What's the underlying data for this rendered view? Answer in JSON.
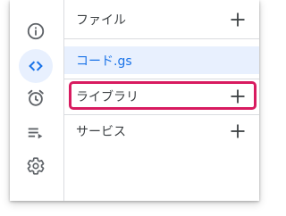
{
  "sidebar": {
    "items": [
      {
        "name": "info",
        "icon": "info-icon",
        "active": false
      },
      {
        "name": "editor",
        "icon": "code-icon",
        "active": true
      },
      {
        "name": "triggers",
        "icon": "alarm-clock-icon",
        "active": false
      },
      {
        "name": "executions",
        "icon": "executions-icon",
        "active": false
      },
      {
        "name": "settings",
        "icon": "gear-icon",
        "active": false
      }
    ]
  },
  "panel": {
    "files_label": "ファイル",
    "file_item": "コード.gs",
    "libraries_label": "ライブラリ",
    "services_label": "サービス"
  },
  "colors": {
    "accent_blue": "#1a73e8",
    "active_bg": "#e8f0fe",
    "highlight_pink": "#d81b60",
    "icon_gray": "#5f6368"
  }
}
